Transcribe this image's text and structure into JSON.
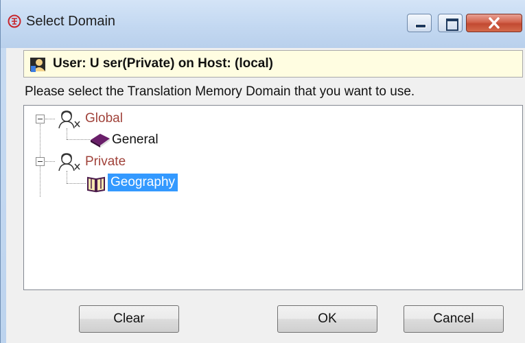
{
  "window": {
    "title": "Select Domain"
  },
  "banner": {
    "user_text": "User: U ser(Private) on Host: (local)"
  },
  "instruction": "Please select the Translation Memory Domain that you want to use.",
  "tree": {
    "nodes": [
      {
        "label": "Global",
        "children": [
          {
            "label": "General"
          }
        ]
      },
      {
        "label": "Private",
        "children": [
          {
            "label": "Geography",
            "selected": true
          }
        ]
      }
    ]
  },
  "buttons": {
    "clear": "Clear",
    "ok": "OK",
    "cancel": "Cancel"
  },
  "colors": {
    "title_bg": "#c3d8f1",
    "banner_bg": "#fffde1",
    "node_label": "#a0423a",
    "selection": "#3399ff",
    "book_closed": "#6a1f6a"
  }
}
